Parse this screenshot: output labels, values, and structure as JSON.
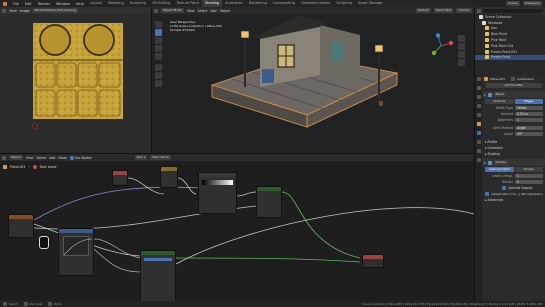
{
  "topbar": {
    "menus": [
      "File",
      "Edit",
      "Render",
      "Window",
      "Help"
    ],
    "workspaces": [
      "Layout",
      "Modeling",
      "Sculpting",
      "UV Editing",
      "Texture Paint",
      "Shading",
      "Animation",
      "Rendering",
      "Compositing",
      "Geometry Nodes",
      "Scripting",
      "Asset Manage"
    ],
    "active_workspace": "Shading",
    "scene_label": "Scene",
    "view_layer_label": "ViewLayer"
  },
  "image_editor": {
    "view": "View",
    "image": "Image",
    "image_name": "WindowTexture_Extruded.png"
  },
  "viewport": {
    "mode": "Object Mode",
    "view": "View",
    "select": "Select",
    "add": "Add",
    "object": "Object",
    "orientation": "Default",
    "drag": "Select Box",
    "options": "Options",
    "info_line1": "User Perspective",
    "info_line2": "(176) Scene Collection | Plane.003",
    "info_line3": "Sample 97/1024"
  },
  "outliner": {
    "search_placeholder": "",
    "rows": [
      {
        "label": "Scene Collection"
      },
      {
        "label": "Windows"
      },
      {
        "label": "Sun"
      },
      {
        "label": "Blue Point"
      },
      {
        "label": "Pink Point"
      },
      {
        "label": "Pink Point.001"
      },
      {
        "label": "Purple Point.001"
      },
      {
        "label": "Purple Point"
      }
    ]
  },
  "properties": {
    "object_name": "Plane.003",
    "modifier_name": "Subdivision",
    "add_modifier": "Add Modifier",
    "bevel_label": "Bevel",
    "bevel_tabs": [
      "Vertices",
      "Edges"
    ],
    "bevel_fields": [
      {
        "label": "Width Type",
        "value": "Offset"
      },
      {
        "label": "Amount",
        "value": "0.03 m"
      },
      {
        "label": "Segments",
        "value": "1"
      },
      {
        "label": "Limit Method",
        "value": "Angle"
      },
      {
        "label": "Angle",
        "value": "30°"
      }
    ],
    "sections": [
      "Profile",
      "Geometry",
      "Shading"
    ],
    "subdiv_label": "Subdiv",
    "subdiv_tabs": [
      "Catmull-Clark",
      "Simple"
    ],
    "subdiv_fields": [
      {
        "label": "Levels Viewp.",
        "value": "1"
      },
      {
        "label": "Render",
        "value": "2"
      }
    ],
    "optimal_display": "Optimal Display",
    "autosmooth": "Autosmooth on Ca...y GPU subdivision",
    "advanced": "Advanced"
  },
  "node_editor": {
    "editor_type": "Object",
    "view": "View",
    "select": "Select",
    "add": "Add",
    "node": "Node",
    "use_nodes": "Use Nodes",
    "slot": "Slot 1",
    "material": "Dark stone",
    "object": "Plane.003",
    "material2": "Dark stone"
  },
  "statusbar": {
    "select": "Select",
    "pan": "Pan View",
    "node": "Node",
    "info": "Scene Collection | Plane.003 | Verts:153,723 | Faces:223,000 | Tris:446,150 | Objects:1/2 | Memory: 4.15 GiB | VRAM: 3.4/8.0 GiB"
  },
  "colors": {
    "accent": "#4772b3",
    "header_orange": "#c86f2e",
    "node_green": "#2f5a2d",
    "texture_yellow": "#c7a43b"
  }
}
